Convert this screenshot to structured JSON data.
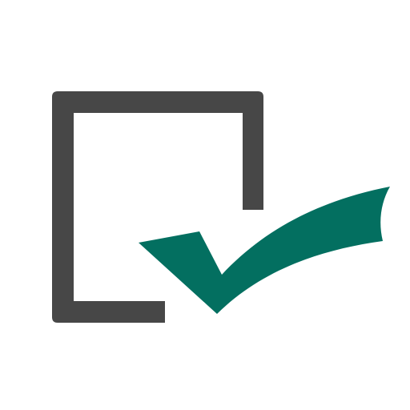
{
  "icon": {
    "name": "checkbox-checked-icon",
    "box_color": "#474747",
    "check_color": "#036f60",
    "background_color": "#ffffff"
  }
}
